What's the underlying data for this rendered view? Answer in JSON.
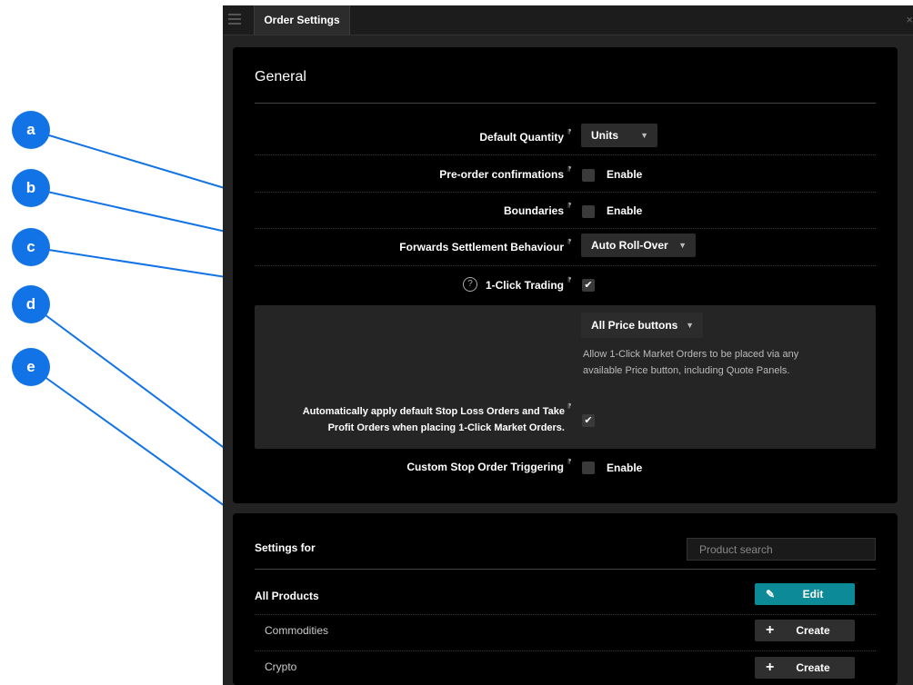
{
  "window": {
    "tab_title": "Order Settings",
    "close_glyph": "×"
  },
  "general": {
    "title": "General",
    "flag_glyph": "⁋",
    "enable_label": "Enable",
    "default_quantity": {
      "label": "Default Quantity",
      "value": "Units",
      "arrow": "▼"
    },
    "preorder_confirmations": {
      "label": "Pre-order confirmations",
      "checked": false
    },
    "boundaries": {
      "label": "Boundaries",
      "checked": false
    },
    "forwards_settlement": {
      "label": "Forwards Settlement Behaviour",
      "value": "Auto Roll-Over",
      "arrow": "▼"
    },
    "one_click_trading": {
      "label": "1-Click Trading",
      "help_glyph": "?",
      "checked": true,
      "check_glyph": "✔"
    },
    "price_buttons": {
      "value": "All Price buttons",
      "arrow": "▼",
      "note_line1": "Allow 1-Click Market Orders to be placed via any",
      "note_line2": "available Price button, including Quote Panels."
    },
    "auto_stop_loss": {
      "label_line1": "Automatically apply default Stop Loss Orders and Take",
      "label_line2": "Profit Orders when placing 1-Click Market Orders.",
      "checked": true,
      "check_glyph": "✔"
    },
    "custom_stop": {
      "label": "Custom Stop Order Triggering",
      "checked": false
    }
  },
  "settings_for": {
    "title": "Settings for",
    "search_placeholder": "Product search",
    "rows": [
      {
        "label": "All Products",
        "button": "Edit",
        "icon": "✎",
        "icon_name": "pencil-icon"
      },
      {
        "label": "Commodities",
        "button": "Create",
        "icon": "+",
        "icon_name": "plus-icon"
      },
      {
        "label": "Crypto",
        "button": "Create",
        "icon": "+",
        "icon_name": "plus-icon"
      }
    ]
  },
  "annotations": [
    "a",
    "b",
    "c",
    "d",
    "e"
  ],
  "colors": {
    "annotation_blue": "#1273e6",
    "edit_button": "#0c8a98",
    "create_button": "#2f2f2f"
  }
}
